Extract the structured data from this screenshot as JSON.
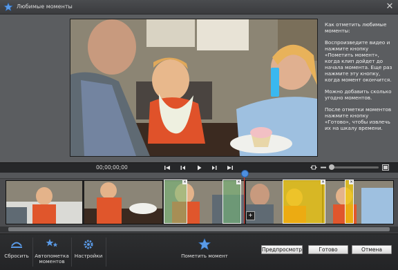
{
  "window": {
    "title": "Любимые моменты",
    "close_glyph": "✕"
  },
  "help": {
    "paragraphs": [
      "Как отметить любимые моменты:",
      "Воспроизведите видео и нажмите кнопку «Пометить момент», когда клип дойдет до начала момента. Еще раз нажмите эту кнопку, когда момент окончится.",
      "Можно добавить сколько угодно моментов.",
      "После отметки моментов нажмите кнопку «Готово», чтобы извлечь их на шкалу времени."
    ]
  },
  "playback": {
    "timecode": "00;00;00;00",
    "controls": [
      "go-to-start-icon",
      "step-back-icon",
      "play-icon",
      "step-forward-icon",
      "go-to-end-icon"
    ]
  },
  "toolbar": {
    "reset_label": "Сбросить",
    "auto_mark_label": "Автопометка моментов",
    "settings_label": "Настройки",
    "mark_moment_label": "Пометить момент",
    "preview_label": "Предпросмотр",
    "done_label": "Готово",
    "cancel_label": "Отмена"
  },
  "colors": {
    "accent_blue": "#4d8fe0",
    "moment_green": "#78be78",
    "moment_yellow": "#f0c80a",
    "playhead_red": "#e03a2f"
  }
}
